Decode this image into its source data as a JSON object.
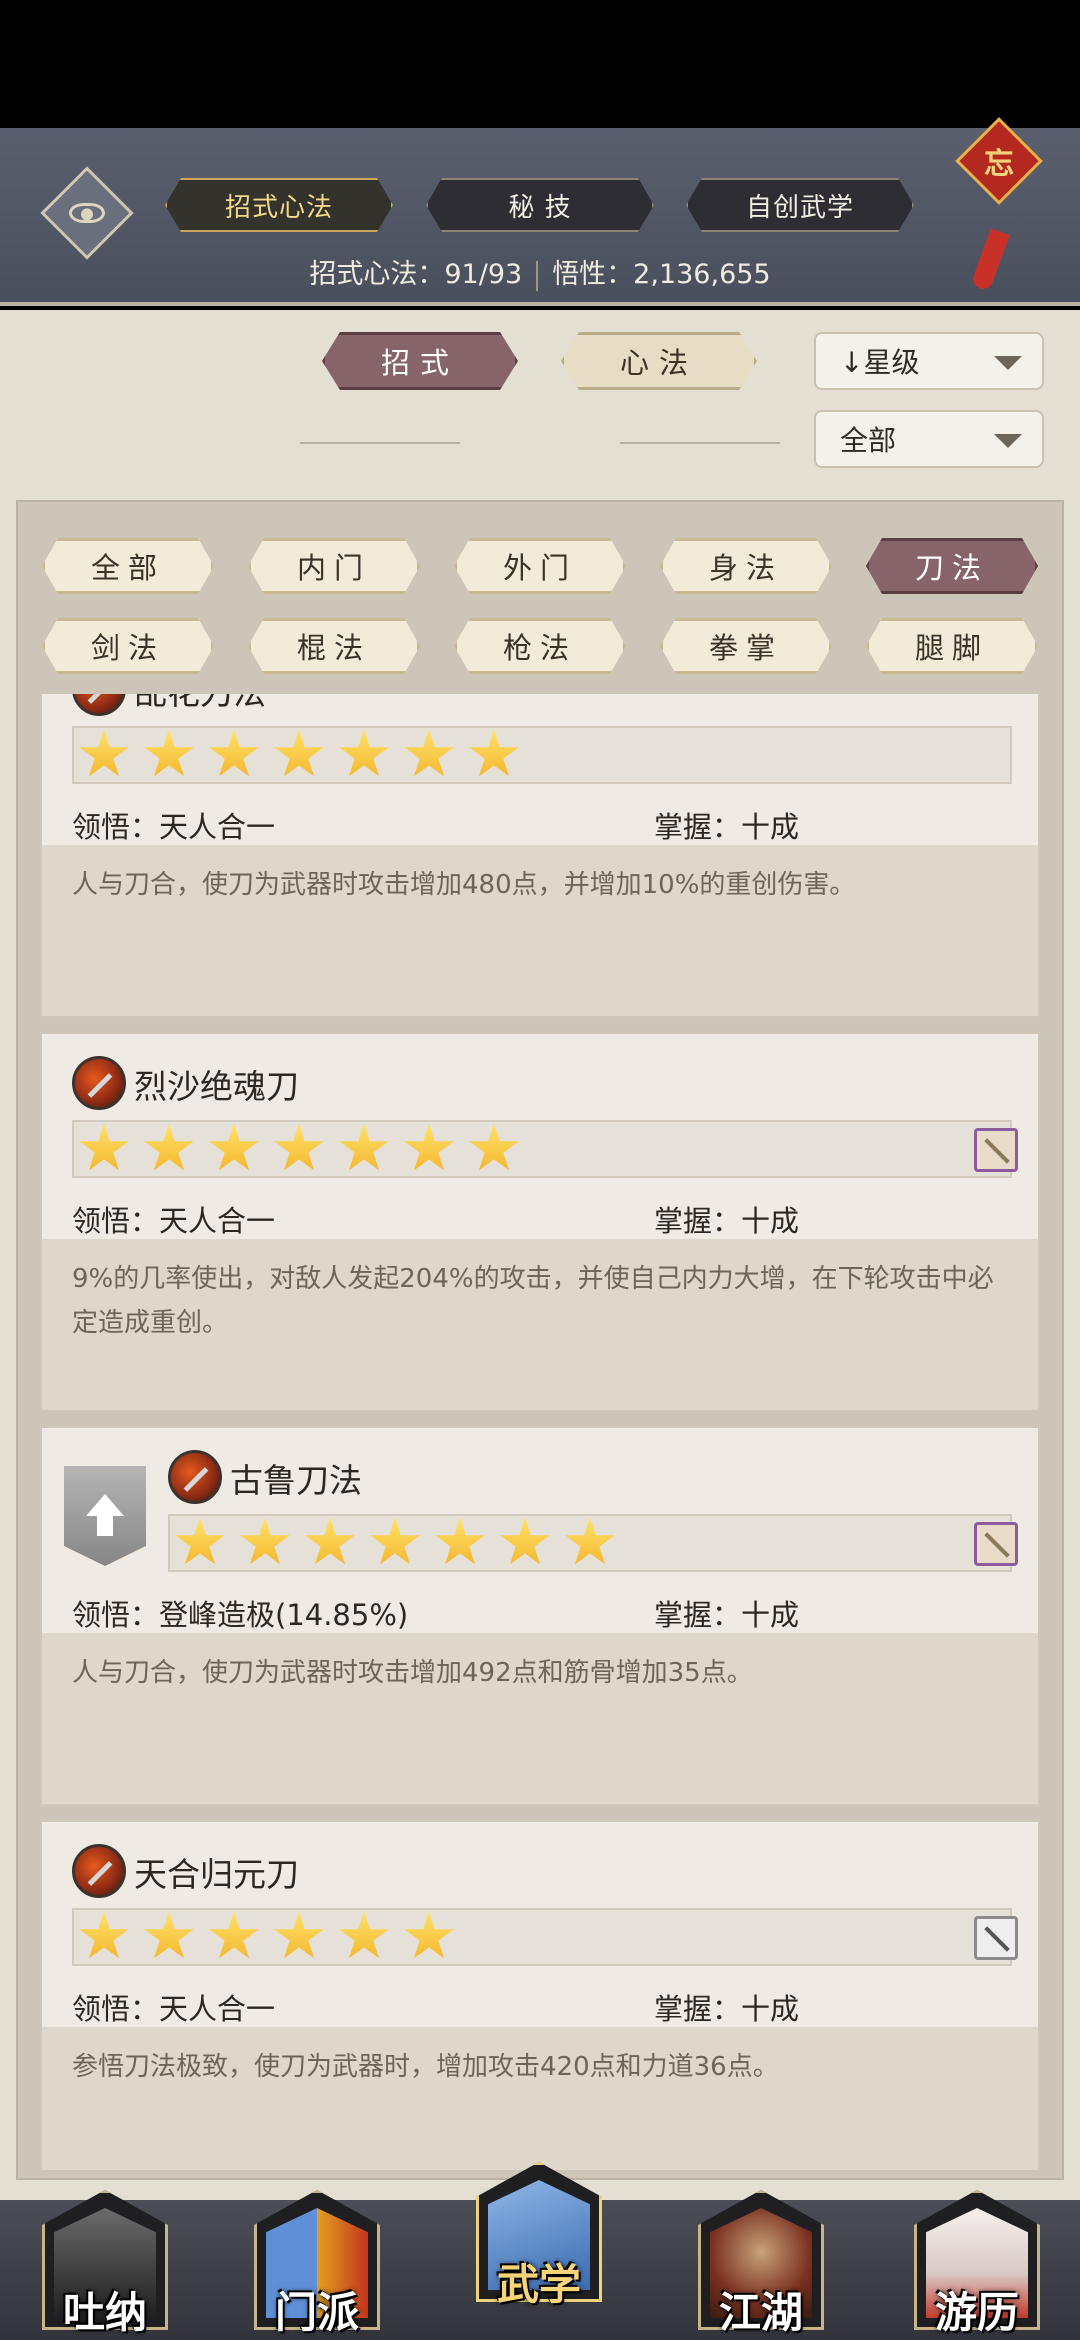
{
  "header": {
    "tabs": [
      {
        "label": "招式心法",
        "active": true
      },
      {
        "label": "秘 技",
        "active": false
      },
      {
        "label": "自创武学",
        "active": false
      }
    ],
    "stats_left": "招式心法：91/93",
    "stats_right": "悟性：2,136,655",
    "charm_text": "忘"
  },
  "controls": {
    "segments": [
      {
        "label": "招式",
        "active": true
      },
      {
        "label": "心法",
        "active": false
      }
    ],
    "sort_dropdown": "↓星级",
    "filter_dropdown": "全部"
  },
  "filters": [
    {
      "label": "全部",
      "active": false
    },
    {
      "label": "内门",
      "active": false
    },
    {
      "label": "外门",
      "active": false
    },
    {
      "label": "身法",
      "active": false
    },
    {
      "label": "刀法",
      "active": true
    },
    {
      "label": "剑法",
      "active": false
    },
    {
      "label": "棍法",
      "active": false
    },
    {
      "label": "枪法",
      "active": false
    },
    {
      "label": "拳掌",
      "active": false
    },
    {
      "label": "腿脚",
      "active": false
    }
  ],
  "skills": [
    {
      "name": "乱花刀法",
      "stars": 7,
      "comprehension": "领悟：天人合一",
      "mastery": "掌握：十成",
      "desc": "人与刀合，使刀为武器时攻击增加480点，并增加10%的重创伤害。",
      "weapon_icon": "none",
      "upgrade": false
    },
    {
      "name": "烈沙绝魂刀",
      "stars": 7,
      "comprehension": "领悟：天人合一",
      "mastery": "掌握：十成",
      "desc": "9%的几率使出，对敌人发起204%的攻击，并使自己内力大增，在下轮攻击中必定造成重创。",
      "weapon_icon": "purple",
      "upgrade": false
    },
    {
      "name": "古鲁刀法",
      "stars": 7,
      "comprehension": "领悟：登峰造极(14.85%)",
      "mastery": "掌握：十成",
      "desc": "人与刀合，使刀为武器时攻击增加492点和筋骨增加35点。",
      "weapon_icon": "purple",
      "upgrade": true
    },
    {
      "name": "天合归元刀",
      "stars": 6,
      "comprehension": "领悟：天人合一",
      "mastery": "掌握：十成",
      "desc": "参悟刀法极致，使刀为武器时，增加攻击420点和力道36点。",
      "weapon_icon": "gray",
      "upgrade": false
    }
  ],
  "bottom_nav": [
    {
      "label": "吐纳",
      "active": false
    },
    {
      "label": "门派",
      "active": false
    },
    {
      "label": "武学",
      "active": true
    },
    {
      "label": "江湖",
      "active": false
    },
    {
      "label": "游历",
      "active": false
    }
  ]
}
